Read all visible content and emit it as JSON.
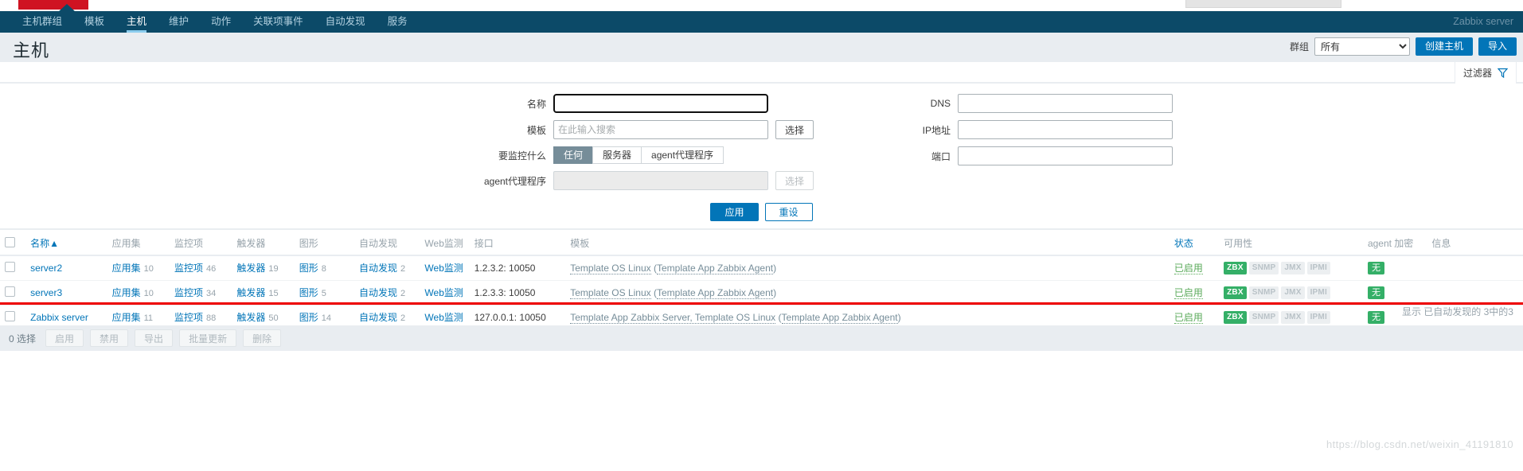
{
  "browser": {
    "tab_accent_color": "#cf1322"
  },
  "nav": {
    "items": [
      {
        "label": "主机群组",
        "active": false
      },
      {
        "label": "模板",
        "active": false
      },
      {
        "label": "主机",
        "active": true
      },
      {
        "label": "维护",
        "active": false
      },
      {
        "label": "动作",
        "active": false
      },
      {
        "label": "关联项事件",
        "active": false
      },
      {
        "label": "自动发现",
        "active": false
      },
      {
        "label": "服务",
        "active": false
      }
    ],
    "user": "Zabbix server",
    "background_color": "#0c4a68",
    "active_underline_color": "#8ccdee"
  },
  "header": {
    "title": "主机",
    "group_label": "群组",
    "group_value": "所有",
    "group_options": [
      "所有"
    ],
    "create_host_label": "创建主机",
    "import_label": "导入",
    "accent_color": "#0275b8"
  },
  "filter": {
    "tab_label": "过滤器",
    "left": {
      "name_label": "名称",
      "name_value": "",
      "name_placeholder": "",
      "template_label": "模板",
      "template_value": "",
      "template_placeholder": "在此输入搜索",
      "template_select_label": "选择",
      "monitored_by_label": "要监控什么",
      "monitored_by_options": [
        "任何",
        "服务器",
        "agent代理程序"
      ],
      "monitored_by_selected": "任何",
      "proxy_label": "agent代理程序",
      "proxy_value": "",
      "proxy_select_label": "选择"
    },
    "right": {
      "dns_label": "DNS",
      "dns_value": "",
      "ip_label": "IP地址",
      "ip_value": "",
      "port_label": "端口",
      "port_value": ""
    },
    "apply_label": "应用",
    "reset_label": "重设"
  },
  "table": {
    "headers": [
      {
        "label": "名称",
        "sortable": true,
        "sort": "▲"
      },
      {
        "label": "应用集",
        "sortable": false
      },
      {
        "label": "监控项",
        "sortable": false
      },
      {
        "label": "触发器",
        "sortable": false
      },
      {
        "label": "图形",
        "sortable": false
      },
      {
        "label": "自动发现",
        "sortable": false
      },
      {
        "label": "Web监测",
        "sortable": false
      },
      {
        "label": "接口",
        "sortable": false
      },
      {
        "label": "模板",
        "sortable": false
      },
      {
        "label": "状态",
        "sortable": true
      },
      {
        "label": "可用性",
        "sortable": false
      },
      {
        "label": "agent 加密",
        "sortable": false
      },
      {
        "label": "信息",
        "sortable": false
      }
    ],
    "labels": {
      "applications": "应用集",
      "items": "监控项",
      "triggers": "触发器",
      "graphs": "图形",
      "discovery": "自动发现",
      "web": "Web监测"
    },
    "rows": [
      {
        "name": "server2",
        "applications": "10",
        "items": "46",
        "triggers": "19",
        "graphs": "8",
        "discovery": "2",
        "interface": "1.2.3.2: 10050",
        "templates_prefix": "Template OS Linux",
        "templates_paren_open": " (",
        "templates_nested": "Template App Zabbix Agent",
        "templates_paren_close": ")",
        "status": "已启用",
        "availability": [
          {
            "label": "ZBX",
            "state": "on"
          },
          {
            "label": "SNMP",
            "state": "off"
          },
          {
            "label": "JMX",
            "state": "off"
          },
          {
            "label": "IPMI",
            "state": "off"
          }
        ],
        "encryption": "无",
        "info": ""
      },
      {
        "name": "server3",
        "applications": "10",
        "items": "34",
        "triggers": "15",
        "graphs": "5",
        "discovery": "2",
        "interface": "1.2.3.3: 10050",
        "templates_prefix": "Template OS Linux",
        "templates_paren_open": " (",
        "templates_nested": "Template App Zabbix Agent",
        "templates_paren_close": ")",
        "status": "已启用",
        "availability": [
          {
            "label": "ZBX",
            "state": "on"
          },
          {
            "label": "SNMP",
            "state": "off"
          },
          {
            "label": "JMX",
            "state": "off"
          },
          {
            "label": "IPMI",
            "state": "off"
          }
        ],
        "encryption": "无",
        "info": ""
      },
      {
        "name": "Zabbix server",
        "applications": "11",
        "items": "88",
        "triggers": "50",
        "graphs": "14",
        "discovery": "2",
        "interface": "127.0.0.1: 10050",
        "templates_prefix": "Template App Zabbix Server, Template OS Linux",
        "templates_paren_open": " (",
        "templates_nested": "Template App Zabbix Agent",
        "templates_paren_close": ")",
        "status": "已启用",
        "availability": [
          {
            "label": "ZBX",
            "state": "on"
          },
          {
            "label": "SNMP",
            "state": "off"
          },
          {
            "label": "JMX",
            "state": "off"
          },
          {
            "label": "IPMI",
            "state": "off"
          }
        ],
        "encryption": "无",
        "info": ""
      }
    ],
    "stats": "显示 已自动发现的 3中的3"
  },
  "footer": {
    "selection": "0 选择",
    "buttons": [
      "启用",
      "禁用",
      "导出",
      "批量更新",
      "删除"
    ]
  },
  "annotation": {
    "highlight_color": "#ee0000",
    "watermark": "https://blog.csdn.net/weixin_41191810"
  }
}
